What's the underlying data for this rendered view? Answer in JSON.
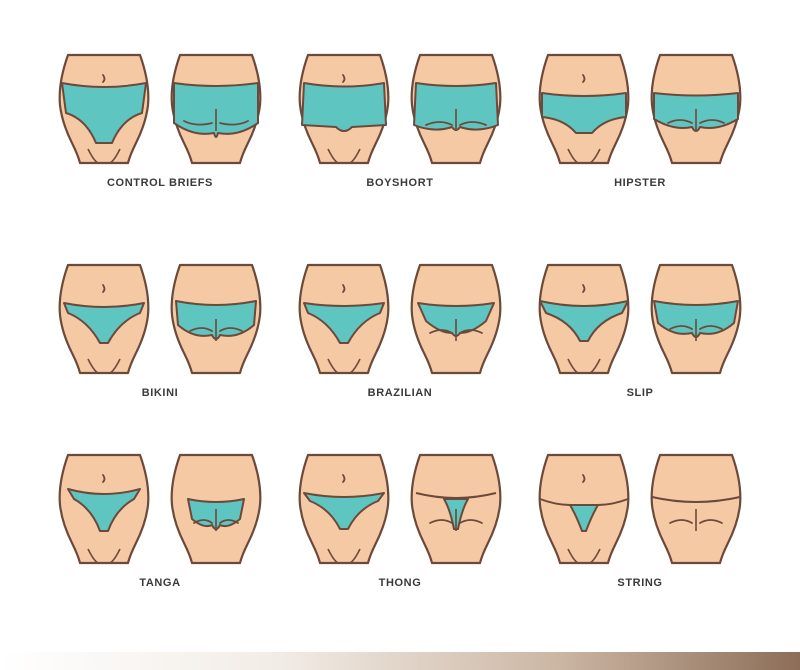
{
  "colors": {
    "skin": "#f5c9a3",
    "outline": "#6b4a3c",
    "garment": "#5fc5c0",
    "label_text": "#3a3a3a"
  },
  "styles": [
    {
      "id": "control-briefs",
      "label": "CONTROL BRIEFS",
      "icon": "control-briefs-icon"
    },
    {
      "id": "boyshort",
      "label": "BOYSHORT",
      "icon": "boyshort-icon"
    },
    {
      "id": "hipster",
      "label": "HIPSTER",
      "icon": "hipster-icon"
    },
    {
      "id": "bikini",
      "label": "BIKINI",
      "icon": "bikini-icon"
    },
    {
      "id": "brazilian",
      "label": "BRAZILIAN",
      "icon": "brazilian-icon"
    },
    {
      "id": "slip",
      "label": "SLIP",
      "icon": "slip-icon"
    },
    {
      "id": "tanga",
      "label": "TANGA",
      "icon": "tanga-icon"
    },
    {
      "id": "thong",
      "label": "THONG",
      "icon": "thong-icon"
    },
    {
      "id": "string",
      "label": "STRING",
      "icon": "string-icon"
    }
  ]
}
